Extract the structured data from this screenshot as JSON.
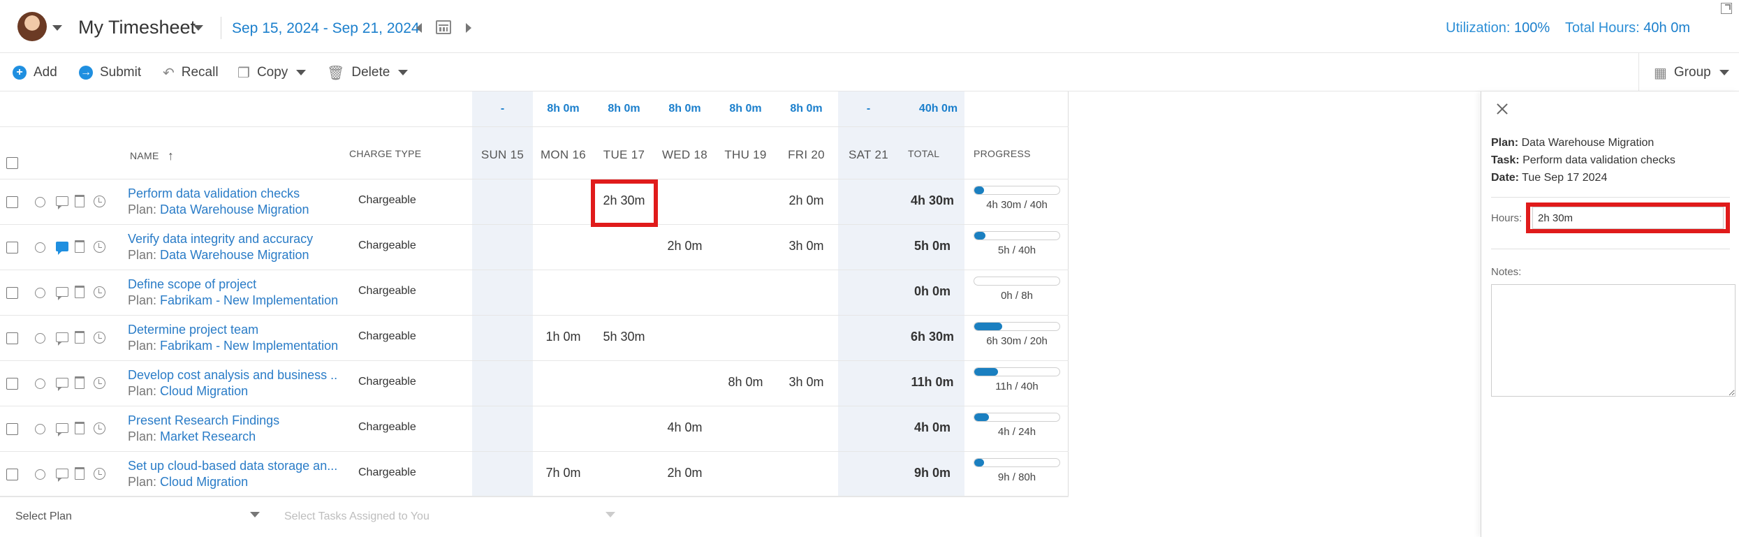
{
  "header": {
    "title": "My Timesheet",
    "date_range": "Sep 15, 2024 - Sep 21, 2024",
    "utilization_label": "Utilization:",
    "utilization_value": "100%",
    "total_hours_label": "Total Hours:",
    "total_hours_value": "40h 0m"
  },
  "toolbar": {
    "add": "Add",
    "submit": "Submit",
    "recall": "Recall",
    "copy": "Copy",
    "delete": "Delete",
    "group": "Group"
  },
  "summary": {
    "sun": "-",
    "mon": "8h 0m",
    "tue": "8h 0m",
    "wed": "8h 0m",
    "thu": "8h 0m",
    "fri": "8h 0m",
    "sat": "-",
    "total": "40h 0m"
  },
  "columns": {
    "name": "NAME",
    "charge_type": "CHARGE TYPE",
    "sun": "SUN 15",
    "mon": "MON 16",
    "tue": "TUE 17",
    "wed": "WED 18",
    "thu": "THU 19",
    "fri": "FRI 20",
    "sat": "SAT 21",
    "total": "TOTAL",
    "progress": "PROGRESS"
  },
  "plan_prefix": "Plan:",
  "rows": [
    {
      "task": "Perform data validation checks",
      "plan": "Data Warehouse Migration",
      "charge": "Chargeable",
      "sun": "",
      "mon": "",
      "tue": "2h 30m",
      "wed": "",
      "thu": "",
      "fri": "2h 0m",
      "sat": "",
      "total": "4h 30m",
      "progress_text": "4h 30m / 40h",
      "progress": 0.1125,
      "has_comment": false
    },
    {
      "task": "Verify data integrity and accuracy",
      "plan": "Data Warehouse Migration",
      "charge": "Chargeable",
      "sun": "",
      "mon": "",
      "tue": "",
      "wed": "2h 0m",
      "thu": "",
      "fri": "3h 0m",
      "sat": "",
      "total": "5h 0m",
      "progress_text": "5h / 40h",
      "progress": 0.125,
      "has_comment": true
    },
    {
      "task": "Define scope of project",
      "plan": "Fabrikam - New Implementation",
      "charge": "Chargeable",
      "sun": "",
      "mon": "",
      "tue": "",
      "wed": "",
      "thu": "",
      "fri": "",
      "sat": "",
      "total": "0h 0m",
      "progress_text": "0h / 8h",
      "progress": 0,
      "has_comment": false
    },
    {
      "task": "Determine project team",
      "plan": "Fabrikam - New Implementation",
      "charge": "Chargeable",
      "sun": "",
      "mon": "1h 0m",
      "tue": "5h 30m",
      "wed": "",
      "thu": "",
      "fri": "",
      "sat": "",
      "total": "6h 30m",
      "progress_text": "6h 30m / 20h",
      "progress": 0.325,
      "has_comment": false
    },
    {
      "task": "Develop cost analysis and business ...",
      "plan": "Cloud Migration",
      "charge": "Chargeable",
      "sun": "",
      "mon": "",
      "tue": "",
      "wed": "",
      "thu": "8h 0m",
      "fri": "3h 0m",
      "sat": "",
      "total": "11h 0m",
      "progress_text": "11h / 40h",
      "progress": 0.275,
      "has_comment": false
    },
    {
      "task": "Present Research Findings",
      "plan": "Market Research",
      "charge": "Chargeable",
      "sun": "",
      "mon": "",
      "tue": "",
      "wed": "4h 0m",
      "thu": "",
      "fri": "",
      "sat": "",
      "total": "4h 0m",
      "progress_text": "4h / 24h",
      "progress": 0.1667,
      "has_comment": false
    },
    {
      "task": "Set up cloud-based data storage an...",
      "plan": "Cloud Migration",
      "charge": "Chargeable",
      "sun": "",
      "mon": "7h 0m",
      "tue": "",
      "wed": "2h 0m",
      "thu": "",
      "fri": "",
      "sat": "",
      "total": "9h 0m",
      "progress_text": "9h / 80h",
      "progress": 0.1125,
      "has_comment": false
    }
  ],
  "bottom": {
    "select_plan": "Select Plan",
    "select_tasks": "Select Tasks Assigned to You"
  },
  "panel": {
    "plan_label": "Plan:",
    "plan_value": "Data Warehouse Migration",
    "task_label": "Task:",
    "task_value": "Perform data validation checks",
    "date_label": "Date:",
    "date_value": "Tue Sep 17 2024",
    "hours_label": "Hours:",
    "hours_value": "2h 30m",
    "notes_label": "Notes:",
    "notes_value": ""
  }
}
